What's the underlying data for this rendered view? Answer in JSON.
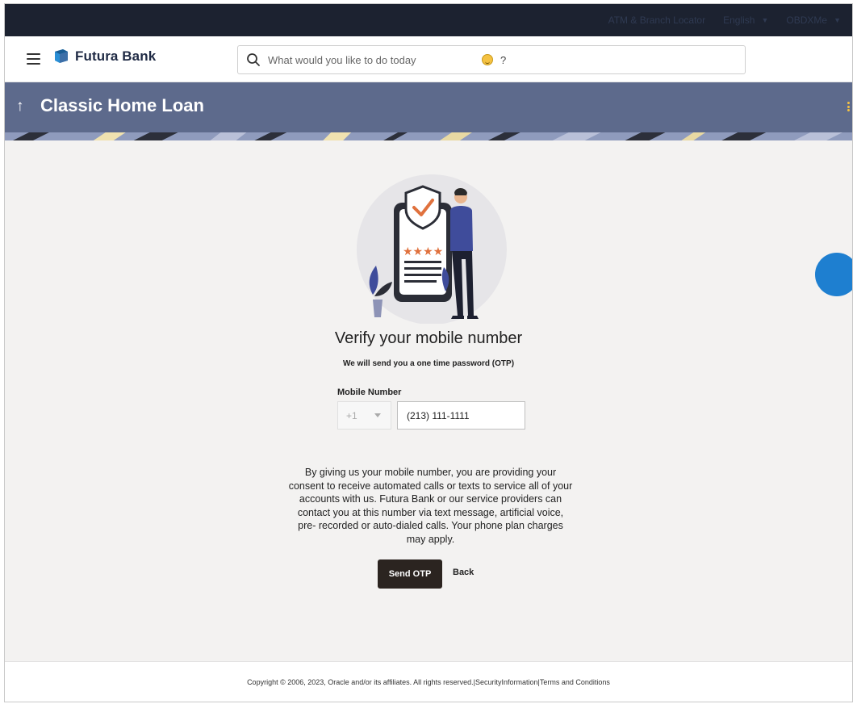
{
  "topbar": {
    "atm_locator": "ATM & Branch Locator",
    "language": "English",
    "user": "OBDXMe"
  },
  "header": {
    "brand_name": "Futura Bank",
    "search_placeholder": "What would you like to do today",
    "search_suffix": "?"
  },
  "banner": {
    "title": "Classic Home Loan"
  },
  "verify": {
    "title": "Verify your mobile number",
    "subtitle": "We will send you a one time password (OTP)",
    "mobile_label": "Mobile Number",
    "country_code": "+1",
    "phone_value": "(213) 111-1111",
    "consent": "By giving us your mobile number, you are providing your consent to receive automated calls or texts to service all of your accounts with us. Futura Bank or our service providers can contact you at this number via text message, artificial voice, pre- recorded or auto-dialed calls. Your phone plan charges may apply.",
    "send_otp": "Send OTP",
    "back": "Back"
  },
  "footer": {
    "copyright": "Copyright © 2006, 2023, Oracle and/or its affiliates. All rights reserved.|SecurityInformation|Terms and Conditions"
  },
  "colors": {
    "topbar": "#1c2230",
    "banner": "#5d6a8c",
    "primary_button": "#2b2420",
    "accent": "#f5c242"
  },
  "icons": [
    "menu-icon",
    "bank-logo-icon",
    "search-icon",
    "smile-emoji-icon",
    "back-arrow-icon",
    "kebab-menu-icon",
    "chevron-down-icon"
  ]
}
